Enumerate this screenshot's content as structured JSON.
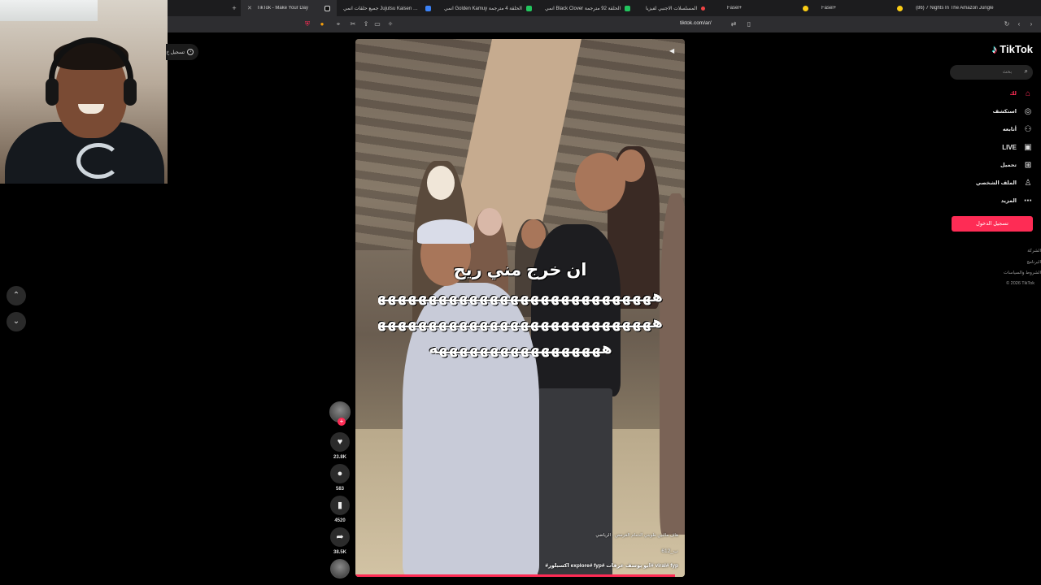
{
  "browser": {
    "tabs": [
      {
        "label": "TikTok - Make Your Day",
        "active": true,
        "favicon_color": "#111111"
      },
      {
        "label": "جميع حلقات انمي Jujutsu Kaisen ملون",
        "favicon_color": "#3b82f6"
      },
      {
        "label": "انمي Golden Kamuy الحلقة 4 مترجمة",
        "favicon_color": "#22c55e"
      },
      {
        "label": "انمي Black Clover الحلقة 92 مترجمة",
        "favicon_color": "#22c55e"
      },
      {
        "label": "المسلسلات الاجنبي لفيزيا",
        "favicon_color": "#ef4444"
      },
      {
        "label": "Fasel+",
        "favicon_color": "#facc15"
      },
      {
        "label": "Fasel+",
        "favicon_color": "#facc15"
      },
      {
        "label": "(86) 7 Nights In The Amazon Jungle",
        "favicon_color": "#facc15"
      }
    ],
    "new_tab": "+",
    "url": "tiktok.com/ar/"
  },
  "left_panel": {
    "back_label": "تسجيل خ",
    "up_icon": "chevron-up-icon",
    "down_icon": "chevron-down-icon"
  },
  "video": {
    "caption_line1": "ان خرج مني ريح",
    "laugh_lines": [
      "هههههههههههههههههههههههههههههههه",
      "هههههههههههههههههههههههههههههههه",
      "هههههههههههههههههه"
    ],
    "description": "هاف مالبين طوبني الدمام القرمص · الرياضي",
    "username": "612_ب",
    "hashtags": "#اكسبلور explore# fyp# ابو يوسف عرفات# viral# fyp",
    "progress": 0.97
  },
  "actions": {
    "like_count": "23.8K",
    "comment_count": "583",
    "save_count": "4520",
    "share_count": "38.5K"
  },
  "sidebar": {
    "brand": "TikTok",
    "search_placeholder": "بحث",
    "nav": [
      {
        "label": "لك",
        "icon": "home-icon",
        "active": true
      },
      {
        "label": "استكشف",
        "icon": "compass-icon"
      },
      {
        "label": "أتابعه",
        "icon": "following-icon"
      },
      {
        "label": "LIVE",
        "icon": "live-icon"
      },
      {
        "label": "تحميل",
        "icon": "upload-icon"
      },
      {
        "label": "الملف الشخصي",
        "icon": "profile-icon"
      },
      {
        "label": "المزيد",
        "icon": "more-icon"
      }
    ],
    "login_label": "تسجيل الدخول",
    "footer": [
      "الشركة",
      "البرنامج",
      "الشروط والسياسات",
      "© 2026 TikTok"
    ]
  },
  "colors": {
    "accent": "#fe2c55",
    "background": "#000000"
  }
}
